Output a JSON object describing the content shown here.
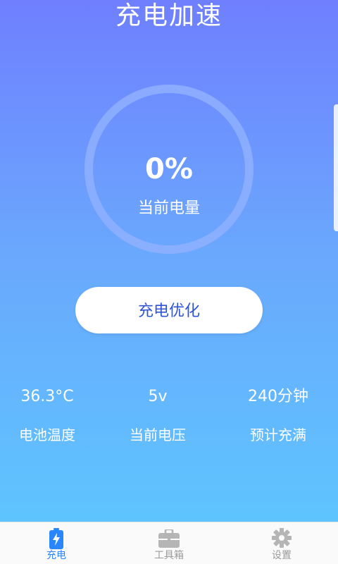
{
  "header": {
    "title": "充电加速"
  },
  "battery": {
    "percent_text": "0%",
    "label": "当前电量",
    "ring_color": "#8fb0ff"
  },
  "action": {
    "optimize_label": "充电优化"
  },
  "stats": [
    {
      "value": "36.3°C",
      "label": "电池温度"
    },
    {
      "value": "5v",
      "label": "当前电压"
    },
    {
      "value": "240分钟",
      "label": "预计充满"
    }
  ],
  "nav": {
    "items": [
      {
        "label": "充电",
        "icon": "battery-charging-icon",
        "active": true
      },
      {
        "label": "工具箱",
        "icon": "toolbox-icon",
        "active": false
      },
      {
        "label": "设置",
        "icon": "gear-icon",
        "active": false
      }
    ],
    "active_color": "#2a86ff",
    "inactive_color": "#9a9a9a"
  }
}
